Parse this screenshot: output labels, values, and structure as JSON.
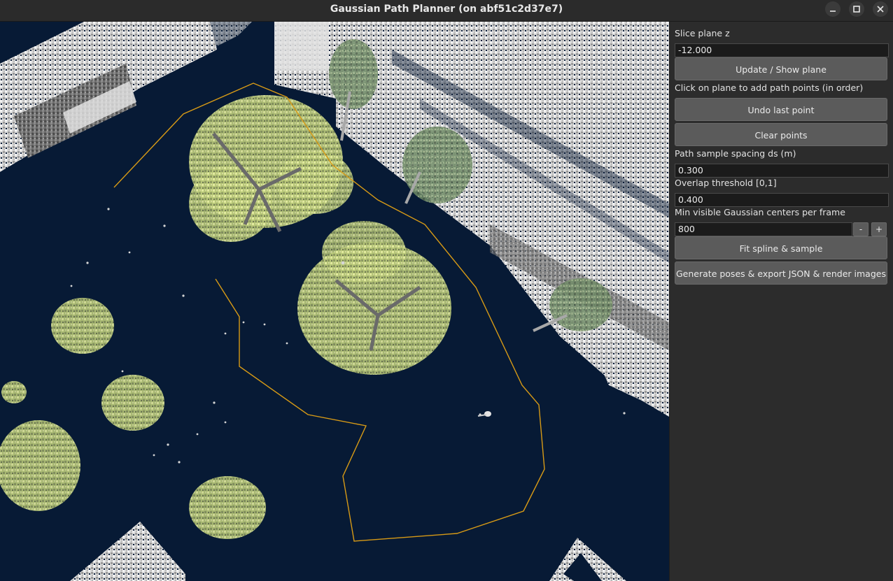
{
  "window": {
    "title": "Gaussian Path Planner (on abf51c2d37e7)"
  },
  "panel": {
    "slice_label": "Slice plane z",
    "slice_value": "-12.000",
    "update_button": "Update / Show plane",
    "instruction": "Click on plane to add path points (in order)",
    "undo_button": "Undo last point",
    "clear_button": "Clear points",
    "spacing_label": "Path sample spacing ds (m)",
    "spacing_value": "0.300",
    "overlap_label": "Overlap threshold [0,1]",
    "overlap_value": "0.400",
    "min_visible_label": "Min visible Gaussian centers per frame",
    "min_visible_value": "800",
    "minus_label": "-",
    "plus_label": "+",
    "fit_button": "Fit spline & sample",
    "generate_button": "Generate poses & export JSON & render images"
  },
  "icons": {
    "minimize": "minimize-icon",
    "maximize": "maximize-icon",
    "close": "close-icon"
  },
  "colors": {
    "viewport_background": "#071a35",
    "path_line": "#d79a16",
    "panel_background": "#2c2c2c"
  }
}
